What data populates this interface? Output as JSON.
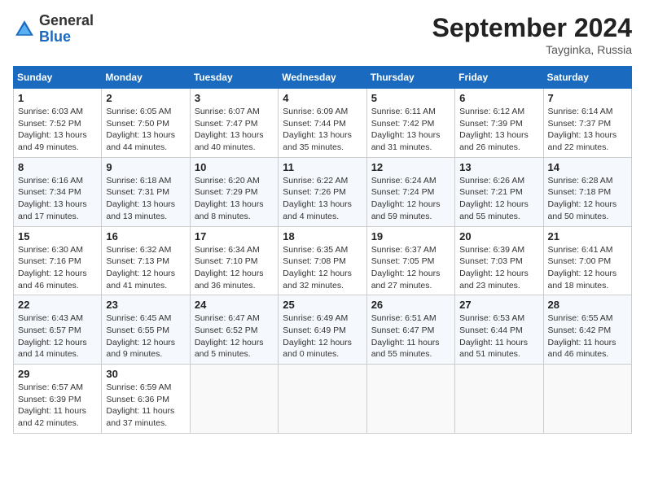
{
  "header": {
    "logo_general": "General",
    "logo_blue": "Blue",
    "month_title": "September 2024",
    "location": "Tayginka, Russia"
  },
  "weekdays": [
    "Sunday",
    "Monday",
    "Tuesday",
    "Wednesday",
    "Thursday",
    "Friday",
    "Saturday"
  ],
  "weeks": [
    [
      {
        "day": "1",
        "sunrise": "6:03 AM",
        "sunset": "7:52 PM",
        "daylight": "13 hours and 49 minutes."
      },
      {
        "day": "2",
        "sunrise": "6:05 AM",
        "sunset": "7:50 PM",
        "daylight": "13 hours and 44 minutes."
      },
      {
        "day": "3",
        "sunrise": "6:07 AM",
        "sunset": "7:47 PM",
        "daylight": "13 hours and 40 minutes."
      },
      {
        "day": "4",
        "sunrise": "6:09 AM",
        "sunset": "7:44 PM",
        "daylight": "13 hours and 35 minutes."
      },
      {
        "day": "5",
        "sunrise": "6:11 AM",
        "sunset": "7:42 PM",
        "daylight": "13 hours and 31 minutes."
      },
      {
        "day": "6",
        "sunrise": "6:12 AM",
        "sunset": "7:39 PM",
        "daylight": "13 hours and 26 minutes."
      },
      {
        "day": "7",
        "sunrise": "6:14 AM",
        "sunset": "7:37 PM",
        "daylight": "13 hours and 22 minutes."
      }
    ],
    [
      {
        "day": "8",
        "sunrise": "6:16 AM",
        "sunset": "7:34 PM",
        "daylight": "13 hours and 17 minutes."
      },
      {
        "day": "9",
        "sunrise": "6:18 AM",
        "sunset": "7:31 PM",
        "daylight": "13 hours and 13 minutes."
      },
      {
        "day": "10",
        "sunrise": "6:20 AM",
        "sunset": "7:29 PM",
        "daylight": "13 hours and 8 minutes."
      },
      {
        "day": "11",
        "sunrise": "6:22 AM",
        "sunset": "7:26 PM",
        "daylight": "13 hours and 4 minutes."
      },
      {
        "day": "12",
        "sunrise": "6:24 AM",
        "sunset": "7:24 PM",
        "daylight": "12 hours and 59 minutes."
      },
      {
        "day": "13",
        "sunrise": "6:26 AM",
        "sunset": "7:21 PM",
        "daylight": "12 hours and 55 minutes."
      },
      {
        "day": "14",
        "sunrise": "6:28 AM",
        "sunset": "7:18 PM",
        "daylight": "12 hours and 50 minutes."
      }
    ],
    [
      {
        "day": "15",
        "sunrise": "6:30 AM",
        "sunset": "7:16 PM",
        "daylight": "12 hours and 46 minutes."
      },
      {
        "day": "16",
        "sunrise": "6:32 AM",
        "sunset": "7:13 PM",
        "daylight": "12 hours and 41 minutes."
      },
      {
        "day": "17",
        "sunrise": "6:34 AM",
        "sunset": "7:10 PM",
        "daylight": "12 hours and 36 minutes."
      },
      {
        "day": "18",
        "sunrise": "6:35 AM",
        "sunset": "7:08 PM",
        "daylight": "12 hours and 32 minutes."
      },
      {
        "day": "19",
        "sunrise": "6:37 AM",
        "sunset": "7:05 PM",
        "daylight": "12 hours and 27 minutes."
      },
      {
        "day": "20",
        "sunrise": "6:39 AM",
        "sunset": "7:03 PM",
        "daylight": "12 hours and 23 minutes."
      },
      {
        "day": "21",
        "sunrise": "6:41 AM",
        "sunset": "7:00 PM",
        "daylight": "12 hours and 18 minutes."
      }
    ],
    [
      {
        "day": "22",
        "sunrise": "6:43 AM",
        "sunset": "6:57 PM",
        "daylight": "12 hours and 14 minutes."
      },
      {
        "day": "23",
        "sunrise": "6:45 AM",
        "sunset": "6:55 PM",
        "daylight": "12 hours and 9 minutes."
      },
      {
        "day": "24",
        "sunrise": "6:47 AM",
        "sunset": "6:52 PM",
        "daylight": "12 hours and 5 minutes."
      },
      {
        "day": "25",
        "sunrise": "6:49 AM",
        "sunset": "6:49 PM",
        "daylight": "12 hours and 0 minutes."
      },
      {
        "day": "26",
        "sunrise": "6:51 AM",
        "sunset": "6:47 PM",
        "daylight": "11 hours and 55 minutes."
      },
      {
        "day": "27",
        "sunrise": "6:53 AM",
        "sunset": "6:44 PM",
        "daylight": "11 hours and 51 minutes."
      },
      {
        "day": "28",
        "sunrise": "6:55 AM",
        "sunset": "6:42 PM",
        "daylight": "11 hours and 46 minutes."
      }
    ],
    [
      {
        "day": "29",
        "sunrise": "6:57 AM",
        "sunset": "6:39 PM",
        "daylight": "11 hours and 42 minutes."
      },
      {
        "day": "30",
        "sunrise": "6:59 AM",
        "sunset": "6:36 PM",
        "daylight": "11 hours and 37 minutes."
      },
      null,
      null,
      null,
      null,
      null
    ]
  ]
}
